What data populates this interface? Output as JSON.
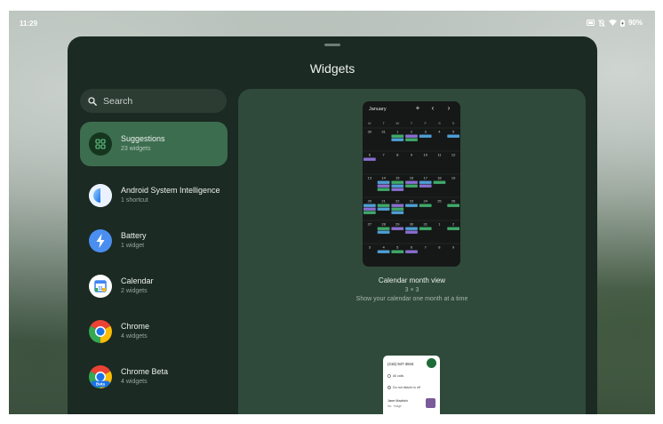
{
  "status_bar": {
    "time": "11:29",
    "battery": "90%"
  },
  "sheet": {
    "title": "Widgets"
  },
  "search": {
    "placeholder": "Search"
  },
  "apps": [
    {
      "name": "Suggestions",
      "count": "23 widgets",
      "icon": "suggestions-icon",
      "selected": true
    },
    {
      "name": "Android System Intelligence",
      "count": "1 shortcut",
      "icon": "android-system-intelligence-icon"
    },
    {
      "name": "Battery",
      "count": "1 widget",
      "icon": "battery-icon"
    },
    {
      "name": "Calendar",
      "count": "2 widgets",
      "icon": "calendar-icon"
    },
    {
      "name": "Chrome",
      "count": "4 widgets",
      "icon": "chrome-icon"
    },
    {
      "name": "Chrome Beta",
      "count": "4 widgets",
      "icon": "chrome-beta-icon",
      "badge": "Beta"
    }
  ],
  "calendar_widget": {
    "month": "January",
    "weekdays": [
      "M",
      "T",
      "W",
      "T",
      "F",
      "S",
      "S"
    ],
    "weeks": [
      [
        "30",
        "31",
        "1",
        "2",
        "3",
        "4",
        "5"
      ],
      [
        "6",
        "7",
        "8",
        "9",
        "10",
        "11",
        "12"
      ],
      [
        "13",
        "14",
        "15",
        "16",
        "17",
        "18",
        "19"
      ],
      [
        "20",
        "21",
        "22",
        "23",
        "24",
        "25",
        "26"
      ],
      [
        "27",
        "28",
        "29",
        "30",
        "31",
        "1",
        "2"
      ],
      [
        "3",
        "4",
        "5",
        "6",
        "7",
        "8",
        "9"
      ]
    ],
    "name": "Calendar month view",
    "size": "3 × 3",
    "description": "Show your calendar one month at a time",
    "colors": {
      "blue": "#4f9fd6",
      "purple": "#8a6fd1",
      "green": "#3faa6a"
    }
  },
  "phone_widget": {
    "number": "(415) 947-3844",
    "rows": [
      "All calls",
      "Do not disturb is off"
    ],
    "contact_name": "Jane Madrich",
    "contact_sub": "Inc. ·image"
  },
  "colors": {
    "sheet_bg": "#1b2a22",
    "selected_item": "#3c6d4f",
    "preview_panel": "#2f4a3b",
    "search_bg": "#2c3c33"
  }
}
